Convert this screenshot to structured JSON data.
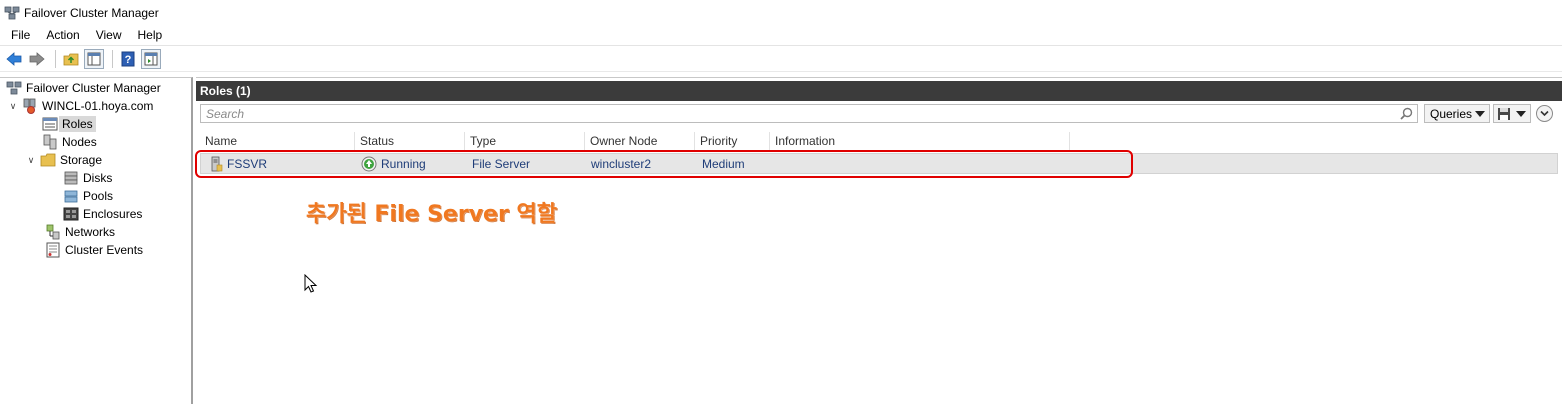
{
  "window": {
    "title": "Failover Cluster Manager"
  },
  "menu": [
    "File",
    "Action",
    "View",
    "Help"
  ],
  "tree": {
    "root": "Failover Cluster Manager",
    "cluster": "WINCL-01.hoya.com",
    "items": {
      "roles": "Roles",
      "nodes": "Nodes",
      "storage": "Storage",
      "disks": "Disks",
      "pools": "Pools",
      "enclosures": "Enclosures",
      "networks": "Networks",
      "cluster_events": "Cluster Events"
    }
  },
  "roles_pane": {
    "header": "Roles (1)",
    "search_placeholder": "Search",
    "queries_label": "Queries",
    "columns": [
      "Name",
      "Status",
      "Type",
      "Owner Node",
      "Priority",
      "Information"
    ],
    "rows": [
      {
        "name": "FSSVR",
        "status": "Running",
        "type": "File Server",
        "owner_node": "wincluster2",
        "priority": "Medium",
        "information": ""
      }
    ]
  },
  "annotation": {
    "text": "추가된 File Server 역할",
    "color": "#f07820"
  },
  "colors": {
    "header_bg": "#3b3b3b",
    "highlight_border": "#e00000",
    "row_bg": "#e6e6e6"
  }
}
